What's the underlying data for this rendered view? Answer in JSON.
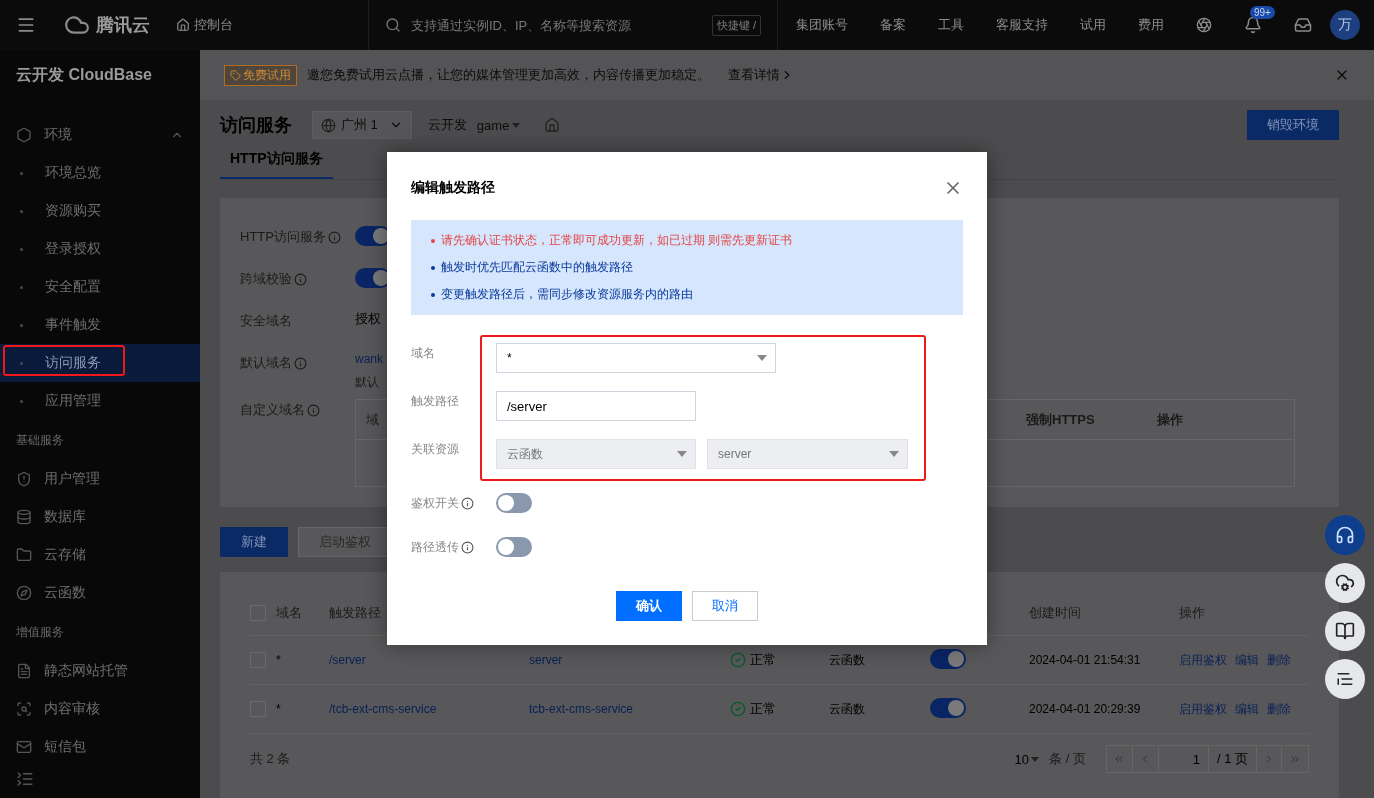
{
  "topbar": {
    "brand": "腾讯云",
    "console": "控制台",
    "search": {
      "placeholder": "支持通过实例ID、IP、名称等搜索资源",
      "shortcut": "快捷键 /"
    },
    "nav": [
      "集团账号",
      "备案",
      "工具",
      "客服支持",
      "试用",
      "费用"
    ],
    "notification_badge": "99+",
    "avatar": "万"
  },
  "sidebar": {
    "title": "云开发 CloudBase",
    "sections": [
      {
        "items": [
          {
            "label": "环境",
            "selected": false,
            "expanded": true,
            "children": [
              {
                "label": "环境总览",
                "selected": false
              },
              {
                "label": "资源购买",
                "selected": false
              },
              {
                "label": "登录授权",
                "selected": false
              },
              {
                "label": "安全配置",
                "selected": false
              },
              {
                "label": "事件触发",
                "selected": false
              },
              {
                "label": "访问服务",
                "selected": true,
                "annotated": true
              },
              {
                "label": "应用管理",
                "selected": false
              }
            ]
          }
        ]
      },
      {
        "heading": "基础服务",
        "items": [
          {
            "label": "用户管理",
            "selected": false
          },
          {
            "label": "数据库",
            "selected": false
          },
          {
            "label": "云存储",
            "selected": false
          },
          {
            "label": "云函数",
            "selected": false
          }
        ]
      },
      {
        "heading": "增值服务",
        "items": [
          {
            "label": "静态网站托管",
            "selected": false
          },
          {
            "label": "内容审核",
            "selected": false
          },
          {
            "label": "短信包",
            "selected": false
          }
        ]
      }
    ]
  },
  "banner": {
    "tag": "免费试用",
    "text": "邀您免费试用云点播，让您的媒体管理更加高效，内容传播更加稳定。",
    "link": "查看详情"
  },
  "header": {
    "title": "访问服务",
    "region": "广州 1",
    "env_label": "云开发",
    "env": "game",
    "destroy_button": "销毁环境"
  },
  "tabs": [
    {
      "label": "HTTP访问服务",
      "selected": true
    }
  ],
  "settings": [
    {
      "label": "HTTP访问服务",
      "info": true,
      "kind": "toggle",
      "on": true
    },
    {
      "label": "跨域校验",
      "info": true,
      "kind": "toggle",
      "on": true
    },
    {
      "label": "安全域名",
      "kind": "text",
      "value": "授权"
    },
    {
      "label": "默认域名",
      "info": true,
      "kind": "link",
      "value": "wank",
      "note": "默认"
    },
    {
      "label": "自定义域名",
      "info": true,
      "kind": "table",
      "columns": [
        "域",
        "强制HTTPS",
        "操作"
      ]
    }
  ],
  "toolbar": [
    {
      "label": "新建",
      "kind": "primary",
      "disabled": false
    },
    {
      "label": "启动鉴权",
      "kind": "default",
      "disabled": true
    }
  ],
  "table": {
    "all_checked": false,
    "columns": [
      {
        "label": "域名"
      },
      {
        "label": "触发路径"
      },
      {},
      {},
      {},
      {},
      {
        "label": "创建时间"
      },
      {
        "label": "操作"
      }
    ],
    "rows": [
      {
        "checked": false,
        "domain": "*",
        "path": "/server",
        "resource": "server",
        "status": "正常",
        "type": "云函数",
        "enabled": true,
        "created": "2024-04-01 21:54:31",
        "actions": [
          "启用鉴权",
          "编辑",
          "删除"
        ]
      },
      {
        "checked": false,
        "domain": "*",
        "path": "/tcb-ext-cms-service",
        "resource": "tcb-ext-cms-service",
        "status": "正常",
        "type": "云函数",
        "enabled": true,
        "created": "2024-04-01 20:29:39",
        "actions": [
          "启用鉴权",
          "编辑",
          "删除"
        ]
      }
    ],
    "footer": {
      "total": "共 2 条",
      "page_size": "10",
      "page_size_unit": "条 / 页",
      "page": "1",
      "page_total": "/ 1 页"
    }
  },
  "modal": {
    "title": "编辑触发路径",
    "notices": [
      {
        "kind": "warning",
        "text": "请先确认证书状态，正常即可成功更新，如已过期 则需先更新证书"
      },
      {
        "kind": "info",
        "text": "触发时优先匹配云函数中的触发路径"
      },
      {
        "kind": "info",
        "text": "变更触发路径后，需同步修改资源服务内的路由"
      }
    ],
    "fields": [
      {
        "label": "域名",
        "kind": "select",
        "value": "*",
        "annotated": true
      },
      {
        "label": "触发路径",
        "kind": "input",
        "value": "/server",
        "annotated": true
      },
      {
        "label": "关联资源",
        "kind": "select_pair",
        "values": [
          "云函数",
          "server"
        ],
        "disabled": true,
        "annotated": true
      },
      {
        "label": "鉴权开关",
        "kind": "toggle",
        "info": true,
        "on": false
      },
      {
        "label": "路径透传",
        "kind": "toggle",
        "info": true,
        "on": false
      }
    ],
    "confirm": "确认",
    "cancel": "取消"
  }
}
